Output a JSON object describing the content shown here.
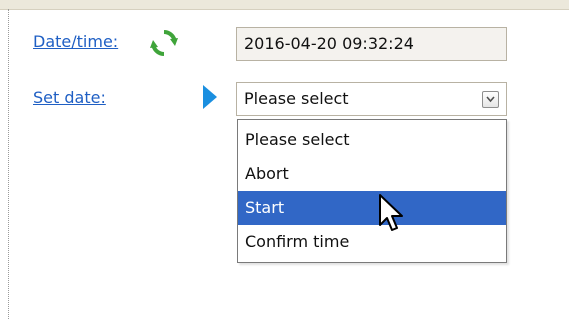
{
  "form": {
    "date_time_label": "Date/time:",
    "date_time_value": "2016-04-20 09:32:24",
    "set_date_label": "Set date:",
    "set_date_selected": "Please select"
  },
  "dropdown": {
    "options": [
      "Please select",
      "Abort",
      "Start",
      "Confirm time"
    ],
    "highlighted": "Start"
  },
  "icons": {
    "refresh": "refresh-icon",
    "active_row_marker": "arrow-marker-icon",
    "dropdown_toggle": "chevron-down-icon",
    "mouse_cursor": "pointer-cursor-icon"
  },
  "colors": {
    "link": "#1f5fc4",
    "selection": "#3167c6",
    "refresh_icon": "#3fa43a",
    "marker": "#1a8fe0"
  }
}
